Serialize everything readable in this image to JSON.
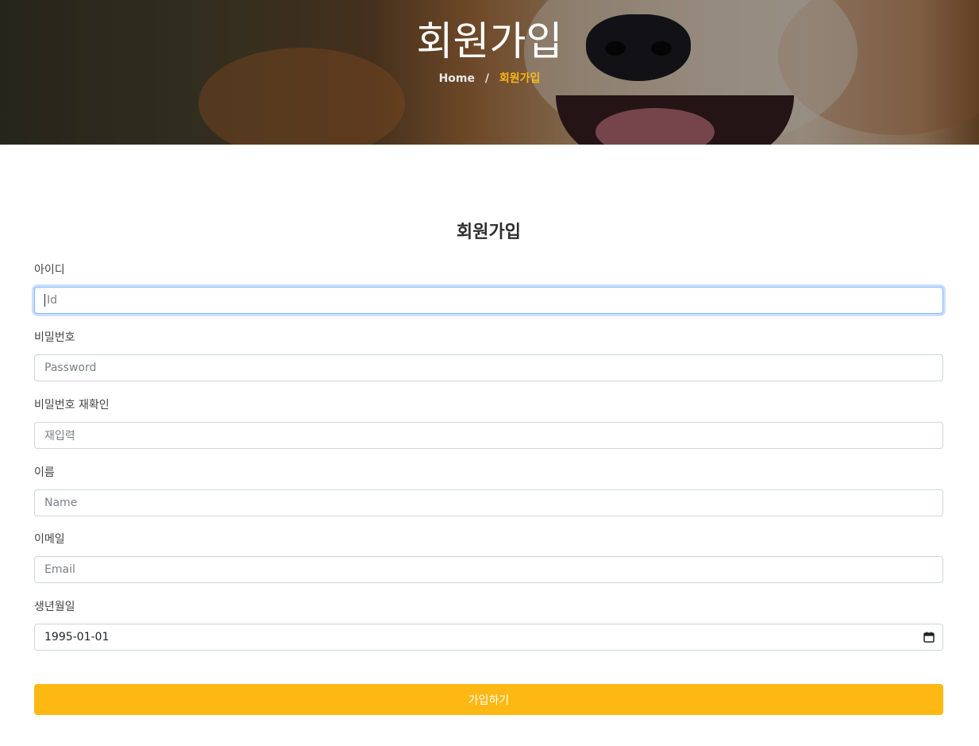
{
  "hero": {
    "title": "회원가입",
    "breadcrumb": {
      "home": "Home",
      "separator": "/",
      "current": "회원가입"
    }
  },
  "form": {
    "title": "회원가입",
    "fields": [
      {
        "label": "아이디",
        "placeholder": "Id",
        "value": ""
      },
      {
        "label": "비밀번호",
        "placeholder": "Password",
        "value": ""
      },
      {
        "label": "비밀번호 재확인",
        "placeholder": "재입력",
        "value": ""
      },
      {
        "label": "이름",
        "placeholder": "Name",
        "value": ""
      },
      {
        "label": "이메일",
        "placeholder": "Email",
        "value": ""
      },
      {
        "label": "생년월일",
        "placeholder": "",
        "value": "1995-01-01"
      }
    ],
    "submit_label": "가입하기"
  },
  "colors": {
    "accent": "#fdb813",
    "focus_border": "#86b7fe"
  },
  "icons": {
    "date_picker": "calendar-icon"
  }
}
